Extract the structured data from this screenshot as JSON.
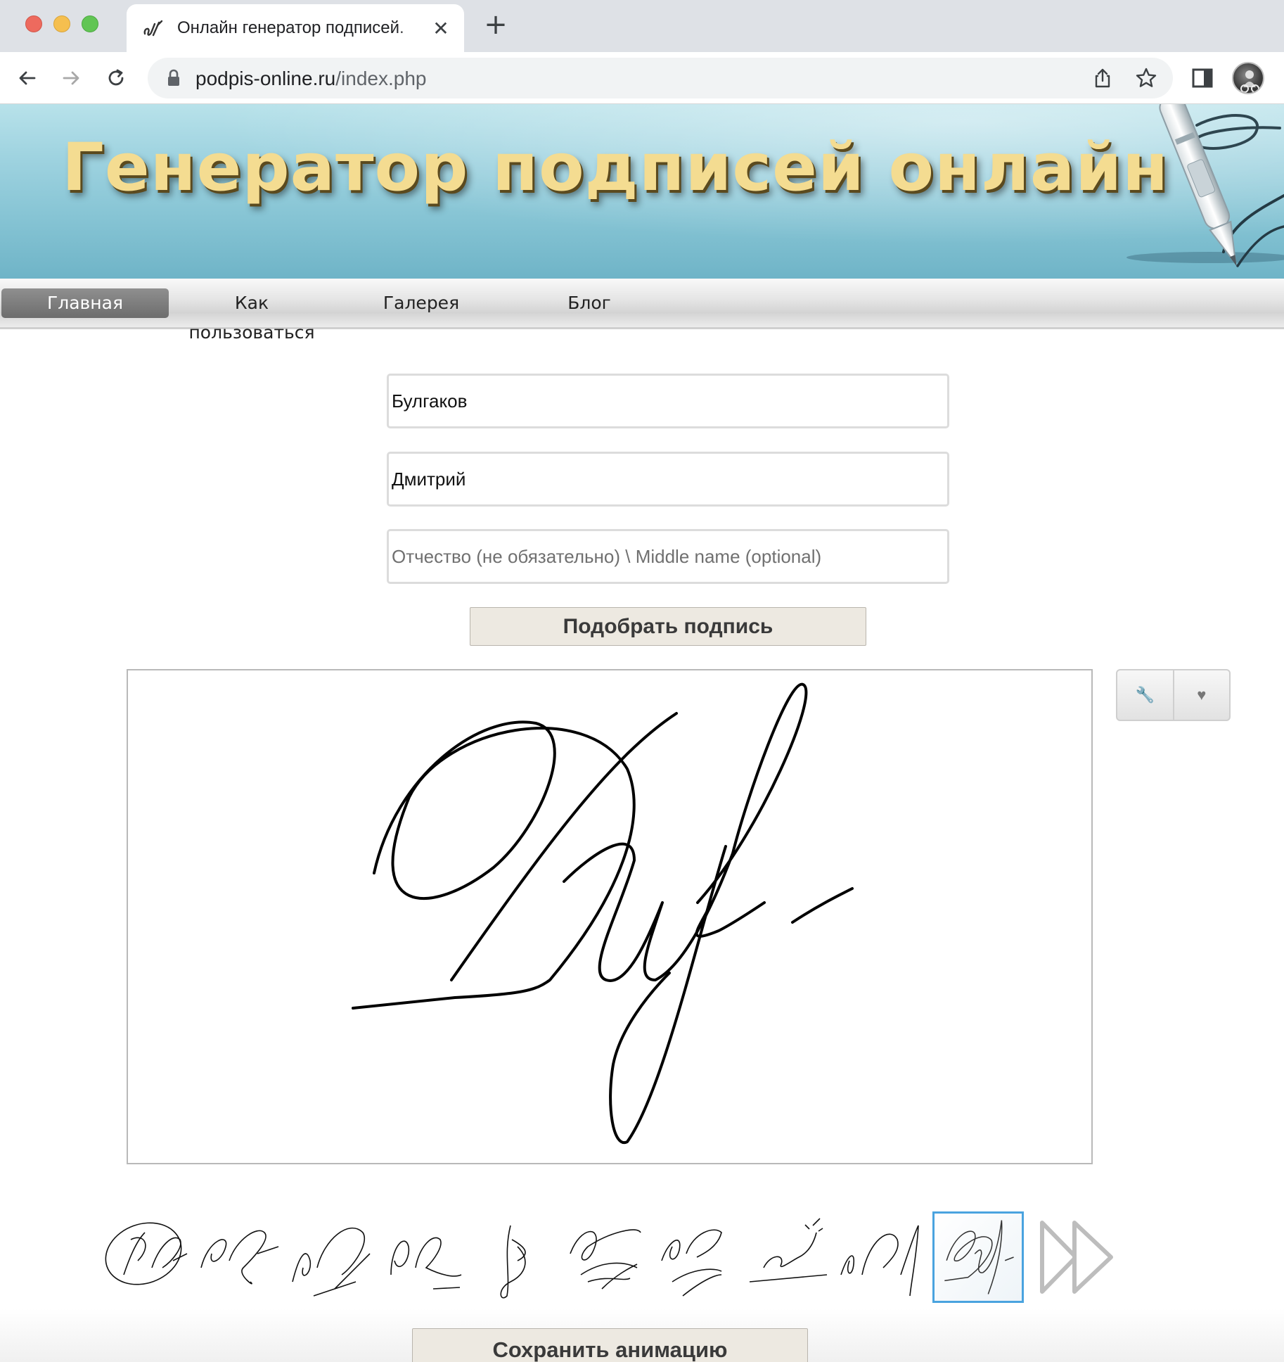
{
  "browser": {
    "tab_title": "Онлайн генератор подписей.",
    "tab_close": "✕",
    "new_tab": "+",
    "url_host": "podpis-online.ru",
    "url_path": "/index.php"
  },
  "site": {
    "header_title": "Генератор подписей онлайн",
    "nav": [
      {
        "label": "Главная",
        "active": true
      },
      {
        "label": "Как пользоваться",
        "active": false
      },
      {
        "label": "Галерея",
        "active": false
      },
      {
        "label": "Блог",
        "active": false
      }
    ]
  },
  "form": {
    "last_name": {
      "value": "Булгаков",
      "placeholder": ""
    },
    "first_name": {
      "value": "Дмитрий",
      "placeholder": ""
    },
    "middle_name": {
      "value": "",
      "placeholder": "Отчество (не обязательно) \\ Middle name (optional)"
    },
    "submit_label": "Подобрать подпись"
  },
  "signature": {
    "tools": [
      {
        "icon": "wrench-icon",
        "glyph": "🔧"
      },
      {
        "icon": "heart-icon",
        "glyph": "♥"
      }
    ],
    "thumbnail_count": 10,
    "selected_thumbnail": 10
  },
  "actions": {
    "save_animation_label": "Сохранить анимацию"
  },
  "colors": {
    "header_gradient_top": "#b8e2ea",
    "header_gradient_bottom": "#6fb4c7",
    "title_gold": "#f4dc91",
    "selected_border": "#4aa3df",
    "button_bg": "#ede9e1"
  }
}
